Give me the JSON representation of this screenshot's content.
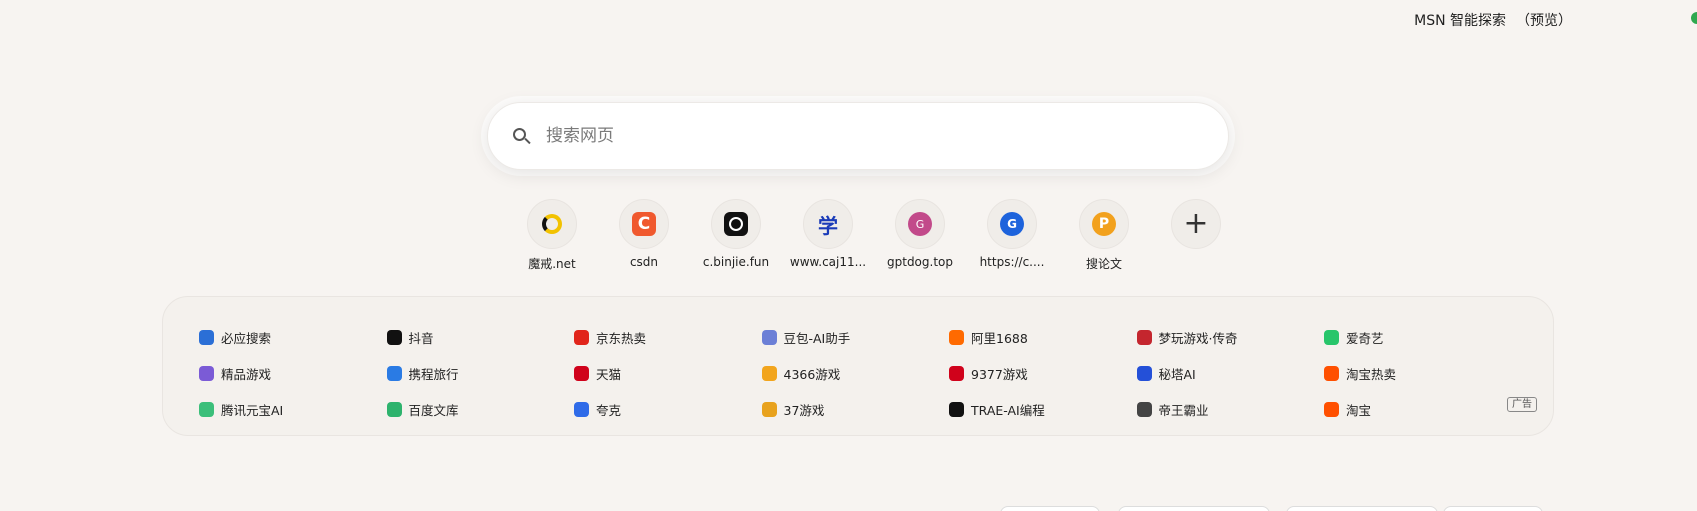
{
  "header": {
    "msn_label": "MSN 智能探索",
    "preview_label": "（预览）"
  },
  "search": {
    "placeholder": "搜索网页"
  },
  "tiles": [
    {
      "label": "魔戒.net",
      "icon": "ring-logo-icon"
    },
    {
      "label": "csdn",
      "icon": "csdn-logo-icon"
    },
    {
      "label": "c.binjie.fun",
      "icon": "openai-logo-icon"
    },
    {
      "label": "www.caj11...",
      "icon": "xue-logo-icon"
    },
    {
      "label": "gptdog.top",
      "icon": "g-pink-logo-icon"
    },
    {
      "label": "https://c....",
      "icon": "g-blue-logo-icon"
    },
    {
      "label": "搜论文",
      "icon": "p-logo-icon"
    },
    {
      "label": "",
      "icon": "plus-icon"
    }
  ],
  "bookmarks": [
    [
      {
        "label": "必应搜索",
        "color": "#2b6fd6"
      },
      {
        "label": "抖音",
        "color": "#111111"
      },
      {
        "label": "京东热卖",
        "color": "#e1251b"
      },
      {
        "label": "豆包-AI助手",
        "color": "#6b7fd6"
      },
      {
        "label": "阿里1688",
        "color": "#ff6a00"
      },
      {
        "label": "梦玩游戏·传奇",
        "color": "#c4262e"
      },
      {
        "label": "爱奇艺",
        "color": "#27c56a"
      }
    ],
    [
      {
        "label": "精品游戏",
        "color": "#7b5bd6"
      },
      {
        "label": "携程旅行",
        "color": "#2a7be4"
      },
      {
        "label": "天猫",
        "color": "#d0021b"
      },
      {
        "label": "4366游戏",
        "color": "#f2a51d"
      },
      {
        "label": "9377游戏",
        "color": "#d0021b"
      },
      {
        "label": "秘塔AI",
        "color": "#2450d8"
      },
      {
        "label": "淘宝热卖",
        "color": "#ff5000"
      }
    ],
    [
      {
        "label": "腾讯元宝AI",
        "color": "#3bbf7a"
      },
      {
        "label": "百度文库",
        "color": "#2db36d"
      },
      {
        "label": "夸克",
        "color": "#2f6be8"
      },
      {
        "label": "37游戏",
        "color": "#e8a21d"
      },
      {
        "label": "TRAE-AI编程",
        "color": "#111111"
      },
      {
        "label": "帝王霸业",
        "color": "#444444"
      },
      {
        "label": "淘宝",
        "color": "#ff5000"
      }
    ]
  ],
  "ad_label": "广告"
}
